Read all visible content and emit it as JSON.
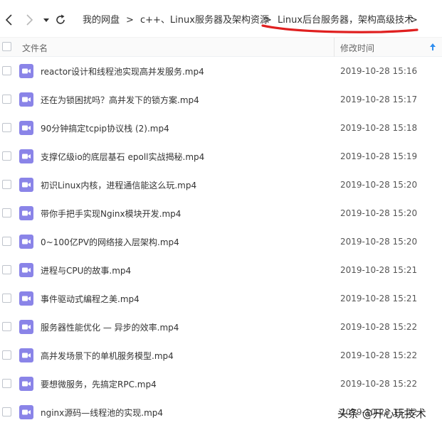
{
  "breadcrumb": {
    "items": [
      "我的网盘",
      "c++、Linux服务器及架构资源",
      "Linux后台服务器，架构高级技术"
    ],
    "separator": ">"
  },
  "header": {
    "name_label": "文件名",
    "time_label": "修改时间"
  },
  "files": [
    {
      "name": "reactor设计和线程池实现高并发服务.mp4",
      "time": "2019-10-28 15:16"
    },
    {
      "name": "还在为锁困扰吗？高并发下的锁方案.mp4",
      "time": "2019-10-28 15:17"
    },
    {
      "name": "90分钟搞定tcpip协议栈 (2).mp4",
      "time": "2019-10-28 15:18"
    },
    {
      "name": "支撑亿级io的底层基石 epoll实战揭秘.mp4",
      "time": "2019-10-28 15:19"
    },
    {
      "name": "初识Linux内核，进程通信能这么玩.mp4",
      "time": "2019-10-28 15:20"
    },
    {
      "name": "带你手把手实现Nginx模块开发.mp4",
      "time": "2019-10-28 15:20"
    },
    {
      "name": "0~100亿PV的网络接入层架构.mp4",
      "time": "2019-10-28 15:20"
    },
    {
      "name": "进程与CPU的故事.mp4",
      "time": "2019-10-28 15:21"
    },
    {
      "name": "事件驱动式编程之美.mp4",
      "time": "2019-10-28 15:21"
    },
    {
      "name": "服务器性能优化 — 异步的效率.mp4",
      "time": "2019-10-28 15:22"
    },
    {
      "name": "高并发场景下的单机服务模型.mp4",
      "time": "2019-10-28 15:22"
    },
    {
      "name": "要想微服务，先搞定RPC.mp4",
      "time": "2019-10-28 15:22"
    },
    {
      "name": "nginx源码—线程池的实现.mp4",
      "time": "2019-10-28 15:22"
    }
  ],
  "watermark": "头条 @开心玩技术",
  "colors": {
    "video_icon": "#8a84e8",
    "sort_arrow": "#2f8ef0",
    "marker": "#e02020"
  },
  "icons": {
    "back": "chevron-left-icon",
    "forward": "chevron-right-icon",
    "history": "caret-down-icon",
    "refresh": "refresh-icon",
    "file": "video-file-icon",
    "sort": "sort-ascending-icon"
  }
}
